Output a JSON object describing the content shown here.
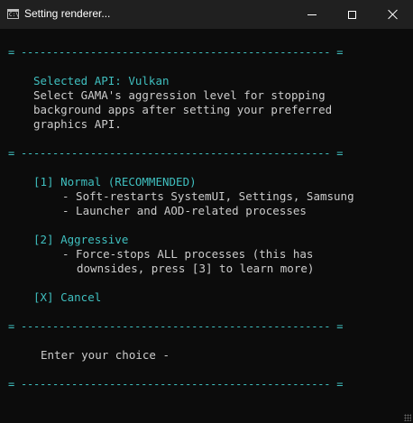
{
  "window": {
    "title": "Setting renderer...",
    "icon": "terminal-icon",
    "controls": {
      "minimize": "minimize-icon",
      "maximize": "maximize-icon",
      "close": "close-icon"
    }
  },
  "separator": "= ------------------------------------------------- =",
  "header": {
    "api_line": "Selected API: Vulkan",
    "description_lines": [
      "Select GAMA's aggression level for stopping",
      "background apps after setting your preferred",
      "graphics API."
    ]
  },
  "options": [
    {
      "label": "[1] Normal (RECOMMENDED)",
      "details": [
        "- Soft-restarts SystemUI, Settings, Samsung",
        "- Launcher and AOD-related processes"
      ]
    },
    {
      "label": "[2] Aggressive",
      "details": [
        "- Force-stops ALL processes (this has",
        "downsides, press [3] to learn more)"
      ]
    },
    {
      "label": "[X] Cancel",
      "details": []
    }
  ],
  "prompt": "Enter your choice -",
  "colors": {
    "accent": "#3fbfbf",
    "text": "#cccccc",
    "background": "#0c0c0c",
    "titlebar": "#202020"
  }
}
